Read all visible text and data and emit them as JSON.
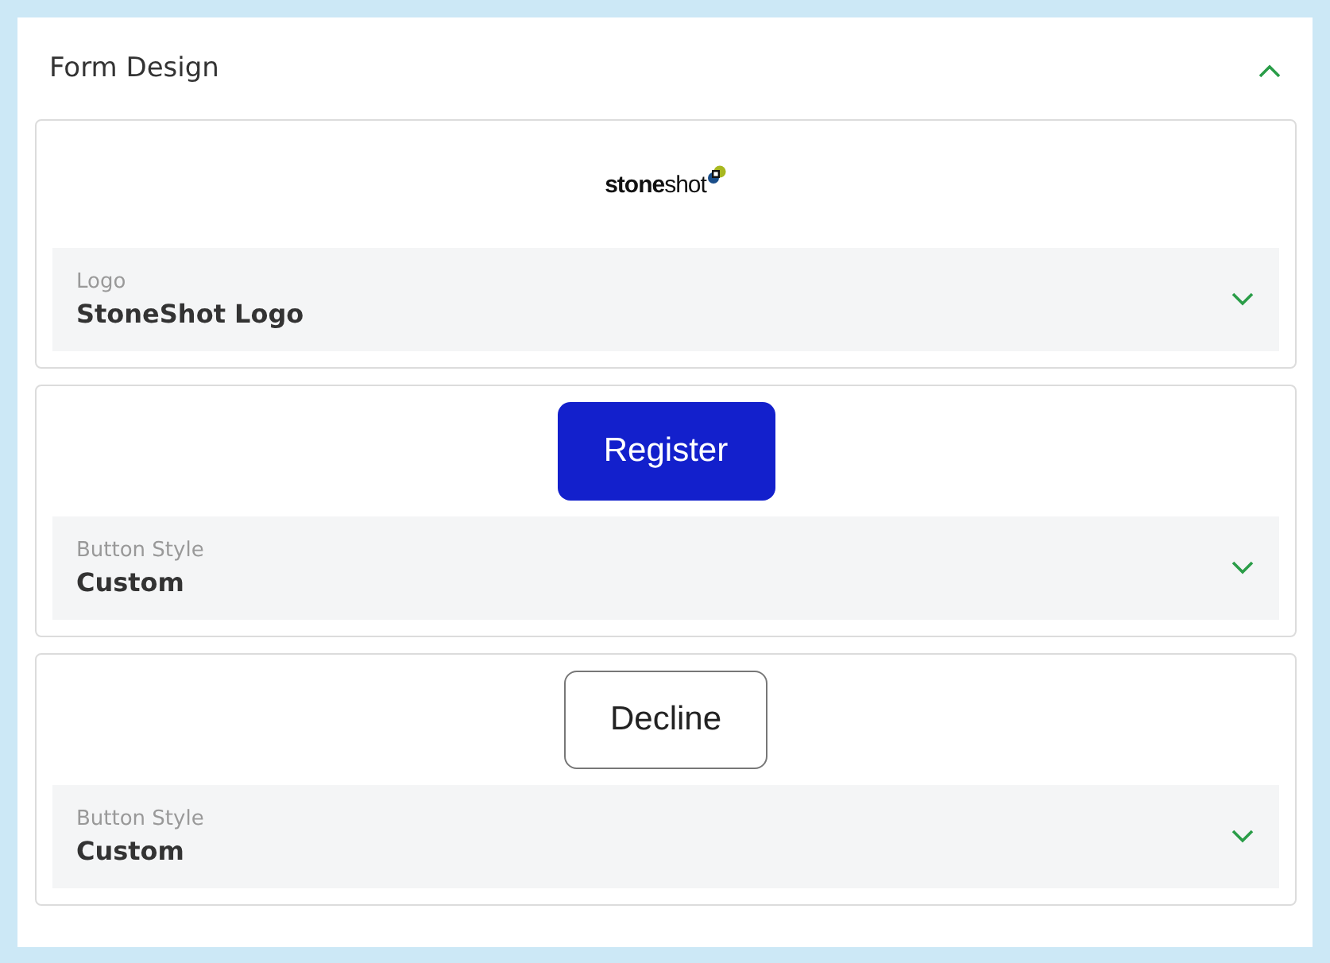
{
  "section": {
    "title": "Form Design",
    "expanded": true
  },
  "cards": [
    {
      "preview": {
        "kind": "logo",
        "text": "**stone**shot"
      },
      "field": {
        "label": "Logo",
        "value": "StoneShot Logo"
      }
    },
    {
      "preview": {
        "kind": "button",
        "label": "Register",
        "filled": true
      },
      "field": {
        "label": "Button Style",
        "value": "Custom"
      }
    },
    {
      "preview": {
        "kind": "button",
        "label": "Decline",
        "filled": false
      },
      "field": {
        "label": "Button Style",
        "value": "Custom"
      }
    }
  ]
}
